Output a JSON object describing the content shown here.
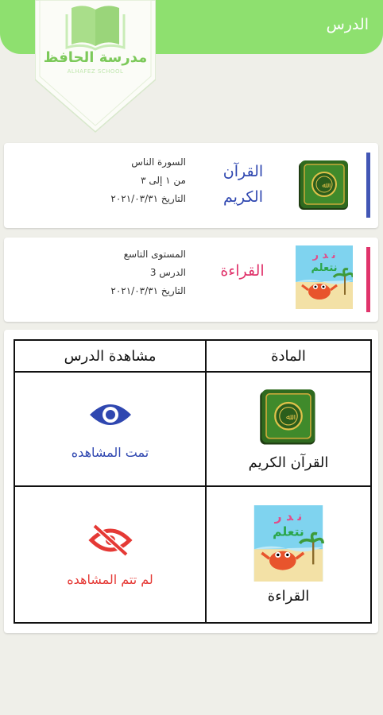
{
  "header": {
    "title": "الدرس"
  },
  "logo": {
    "name": "مدرسة الحافظ",
    "tagline": "ALHAFEZ SCHOOL"
  },
  "lessons": [
    {
      "subject_line1": "القرآن",
      "subject_line2": "الكريم",
      "detail1": "السورة الناس",
      "detail2": "من ١ إلى ٣",
      "detail3": "التاريخ ٢٠٢١/٠٣/٣١",
      "accent_color": "#4256b5",
      "icon": "quran-book-icon"
    },
    {
      "subject_line1": "القراءة",
      "detail1": "المستوى التاسع",
      "detail2": "الدرس 3",
      "detail3": "التاريخ ٢٠٢١/٠٣/٣١",
      "accent_color": "#e0336b",
      "icon": "reading-crab-icon"
    }
  ],
  "table": {
    "header_subject": "المادة",
    "header_view": "مشاهدة الدرس",
    "rows": [
      {
        "subject": "القرآن الكريم",
        "status": "تمت المشاهده",
        "status_icon": "eye-icon",
        "status_color": "#2f47b0"
      },
      {
        "subject": "القراءة",
        "status": "لم تتم المشاهده",
        "status_icon": "eye-off-icon",
        "status_color": "#e53935"
      }
    ]
  }
}
